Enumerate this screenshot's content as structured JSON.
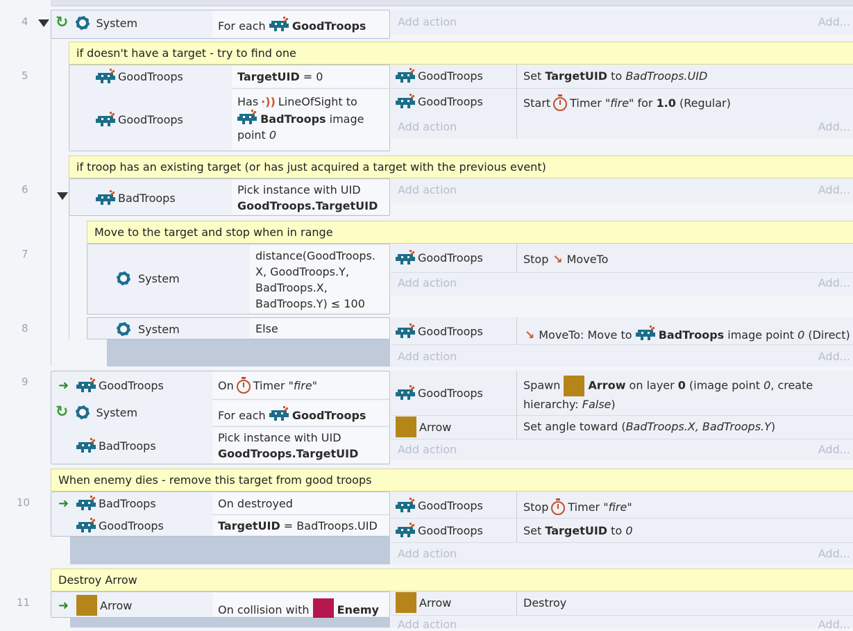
{
  "common": {
    "add_action": "Add action",
    "add_short": "Add...",
    "system": "System",
    "goodtroops": "GoodTroops",
    "badtroops": "BadTroops",
    "arrow": "Arrow",
    "enemy": "Enemy"
  },
  "colors": {
    "arrow_sprite": "#b5851a",
    "enemy_sprite": "#b5174e",
    "comment_bg": "#fdfdc6",
    "troop_icon": "#1c6d88"
  },
  "events": {
    "e4": {
      "num": "4",
      "cond": "For each"
    },
    "c1": {
      "text": "if doesn't have a target - try to find one"
    },
    "e5": {
      "num": "5",
      "cond1_b": "TargetUID",
      "cond1_rest": " = 0",
      "cond2_has": "Has",
      "cond2_los": "LineOfSight to",
      "cond2_bad": "BadTroops",
      "cond2_img": " image",
      "cond2_point": "point ",
      "cond2_zero": "0",
      "act1_pre": "Set ",
      "act1_b": "TargetUID",
      "act1_to": " to ",
      "act1_i": "BadTroops.UID",
      "act2_pre": "Start",
      "act2_timer": "Timer \"",
      "act2_fire": "fire",
      "act2_for": "\" for ",
      "act2_val": "1.0",
      "act2_reg": " (Regular)"
    },
    "c2": {
      "text": "if troop has an existing target (or has just acquired a target with the previous event)"
    },
    "e6": {
      "num": "6",
      "cond1": "Pick instance with UID",
      "cond2": "GoodTroops.TargetUID"
    },
    "c3": {
      "text": "Move to the target and stop when in range"
    },
    "e7": {
      "num": "7",
      "l1": "distance(GoodTroops.",
      "l2": "X, GoodTroops.Y,",
      "l3": "BadTroops.X,",
      "l4": "BadTroops.Y) ≤ 100",
      "act1_pre": "Stop",
      "act1_b": "MoveTo"
    },
    "e8": {
      "num": "8",
      "cond": "Else",
      "act1_pre": "MoveTo: Move to",
      "act1_b": "BadTroops",
      "act1_img": " image point ",
      "act1_zero": "0",
      "act1_rest": " (Direct)"
    },
    "e9": {
      "num": "9",
      "c1_on": "On",
      "c1_timer": "Timer \"",
      "c1_fire": "fire",
      "c1_end": "\"",
      "c2": "For each",
      "c3a": "Pick instance with UID",
      "c3b": "GoodTroops.TargetUID",
      "a1_spawn": "Spawn",
      "a1_b": "Arrow",
      "a1_layer": " on layer ",
      "a1_zero_b": "0",
      "a1_ip": " (image point ",
      "a1_zero_i": "0",
      "a1_create": ", create",
      "a1_hier": "hierarchy: ",
      "a1_false": "False",
      "a1_close": ")",
      "a2_pre": "Set angle toward (",
      "a2_i": "BadTroops.X, BadTroops.Y",
      "a2_close": ")"
    },
    "c4": {
      "text": "When enemy dies - remove this target from good troops"
    },
    "e10": {
      "num": "10",
      "c1": "On destroyed",
      "c2_b": "TargetUID",
      "c2_rest": " = BadTroops.UID",
      "a1_pre": "Stop",
      "a1_timer": "Timer \"",
      "a1_fire": "fire",
      "a1_end": "\"",
      "a2_pre": "Set ",
      "a2_b": "TargetUID",
      "a2_to": " to ",
      "a2_zero": "0"
    },
    "c5": {
      "text": "Destroy Arrow"
    },
    "e11": {
      "num": "11",
      "c1": "On collision with",
      "a1": "Destroy"
    }
  }
}
